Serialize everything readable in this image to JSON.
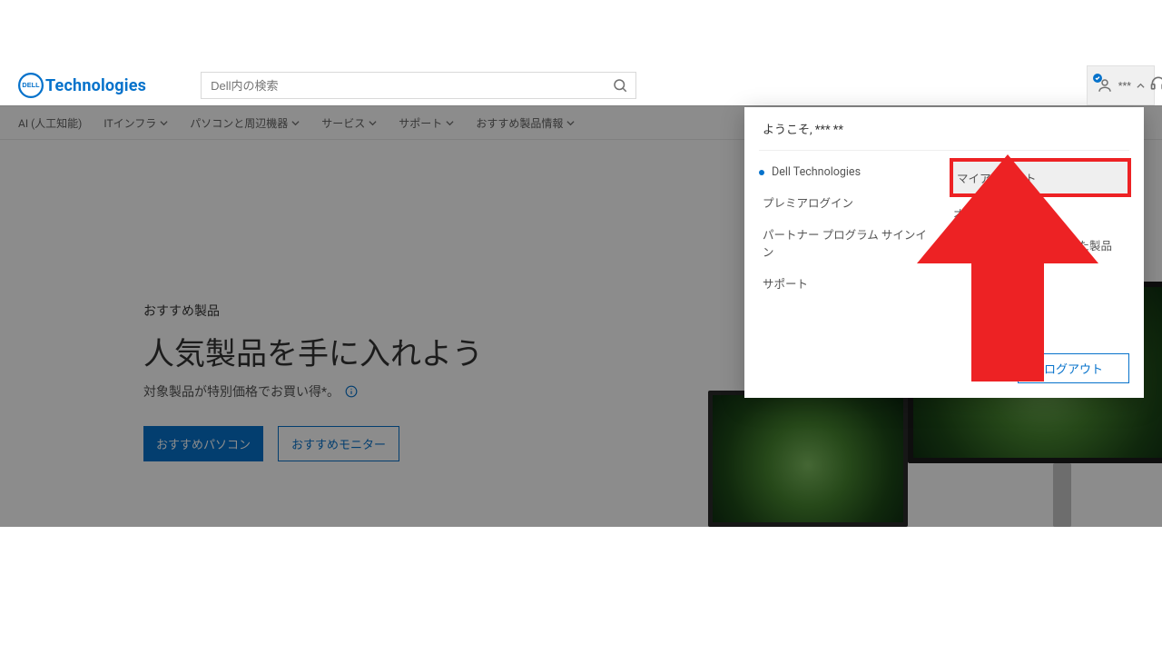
{
  "logo_text": "Technologies",
  "search_placeholder": "Dell内の検索",
  "nav": [
    {
      "label": "AI (人工知能)",
      "caret": false
    },
    {
      "label": "ITインフラ",
      "caret": true
    },
    {
      "label": "パソコンと周辺機器",
      "caret": true
    },
    {
      "label": "サービス",
      "caret": true
    },
    {
      "label": "サポート",
      "caret": true
    },
    {
      "label": "おすすめ製品情報",
      "caret": true
    }
  ],
  "hero": {
    "eyebrow": "おすすめ製品",
    "headline": "人気製品を手に入れよう",
    "sub": "対象製品が特別価格でお買い得*。",
    "cta_primary": "おすすめパソコン",
    "cta_secondary": "おすすめモニター"
  },
  "account": {
    "trigger_name": "***",
    "welcome": "ようこそ, *** **",
    "left_links": [
      {
        "label": "Dell Technologies",
        "active": true
      },
      {
        "label": "プレミアログイン",
        "active": false
      },
      {
        "label": "パートナー プログラム サインイン",
        "active": false
      },
      {
        "label": "サポート",
        "active": false
      }
    ],
    "right_links": [
      {
        "label": "マイアカウント",
        "highlight": true
      },
      {
        "label": "オーダーステータス",
        "highlight": false
      },
      {
        "label": "マイアカウントに保存した製品",
        "highlight": false
      }
    ],
    "logout": "ログアウト"
  }
}
